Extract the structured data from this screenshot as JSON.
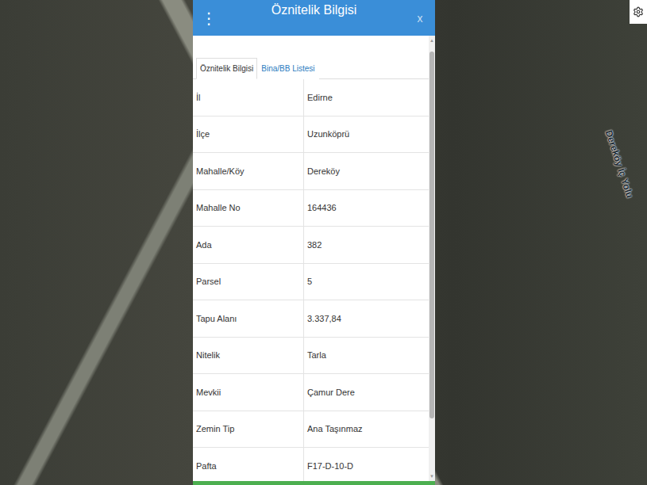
{
  "window": {
    "title": "Öznitelik Bilgisi",
    "menu_glyph": "⋮",
    "close_glyph": "x"
  },
  "tabs": [
    {
      "label": "Öznitelik Bilgisi",
      "selected": true
    },
    {
      "label": "Bina/BB Listesi",
      "selected": false
    }
  ],
  "rows": [
    {
      "label": "İl",
      "value": "Edirne"
    },
    {
      "label": "İlçe",
      "value": "Uzunköprü"
    },
    {
      "label": "Mahalle/Köy",
      "value": "Dereköy"
    },
    {
      "label": "Mahalle No",
      "value": "164436"
    },
    {
      "label": "Ada",
      "value": "382"
    },
    {
      "label": "Parsel",
      "value": "5"
    },
    {
      "label": "Tapu Alanı",
      "value": "3.337,84"
    },
    {
      "label": "Nitelik",
      "value": "Tarla"
    },
    {
      "label": "Mevkii",
      "value": "Çamur Dere"
    },
    {
      "label": "Zemin Tip",
      "value": "Ana Taşınmaz"
    },
    {
      "label": "Pafta",
      "value": "F17-D-10-D"
    }
  ],
  "map": {
    "road_label": "Dereköy İç Yolu"
  },
  "scrollbar": {
    "level": 0.86,
    "up_glyph": "▲",
    "down_glyph": "▼"
  }
}
